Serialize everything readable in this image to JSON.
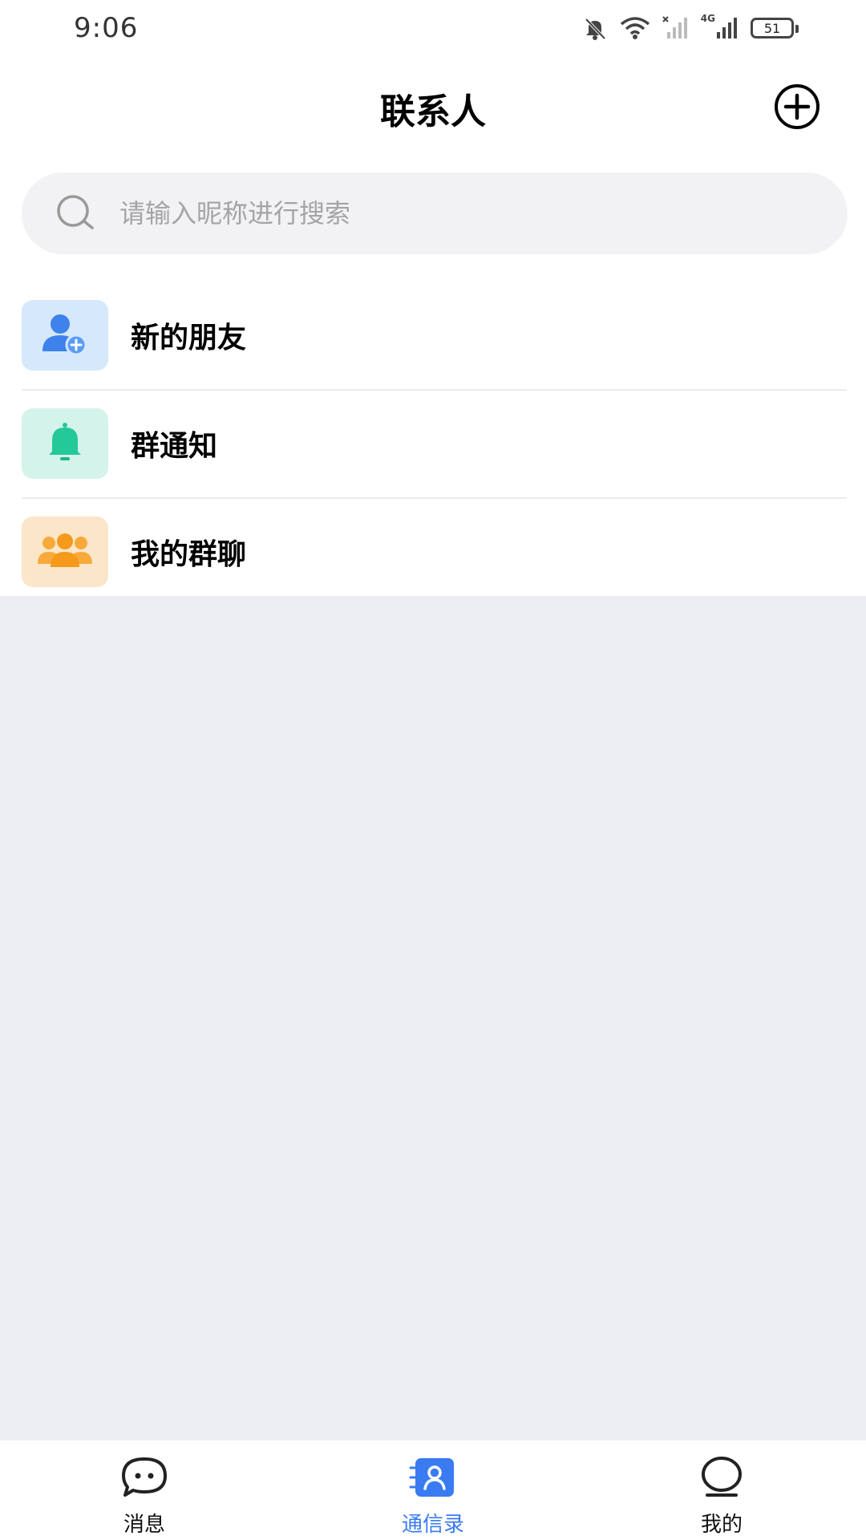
{
  "status_bar": {
    "time": "9:06",
    "network": "4G",
    "battery": "51",
    "icons": [
      "mute-bell-icon",
      "wifi-icon",
      "signal-off-icon",
      "signal-4g-icon",
      "battery-icon"
    ]
  },
  "header": {
    "title": "联系人",
    "add_icon": "plus-circle-icon"
  },
  "search": {
    "placeholder": "请输入昵称进行搜索",
    "value": "",
    "icon": "search-icon"
  },
  "menu": {
    "items": [
      {
        "label": "新的朋友",
        "icon": "add-friend-icon",
        "icon_bg": "#d6e8fc",
        "icon_color": "#3e82ec"
      },
      {
        "label": "群通知",
        "icon": "bell-icon",
        "icon_bg": "#d4f3ea",
        "icon_color": "#24c99a"
      },
      {
        "label": "我的群聊",
        "icon": "group-icon",
        "icon_bg": "#fbe6c9",
        "icon_color": "#f59a1b"
      }
    ]
  },
  "tabs": {
    "items": [
      {
        "label": "消息",
        "icon": "chat-icon",
        "active": false
      },
      {
        "label": "通信录",
        "icon": "contacts-icon",
        "active": true
      },
      {
        "label": "我的",
        "icon": "profile-icon",
        "active": false
      }
    ],
    "active_color": "#3a7bf2"
  }
}
